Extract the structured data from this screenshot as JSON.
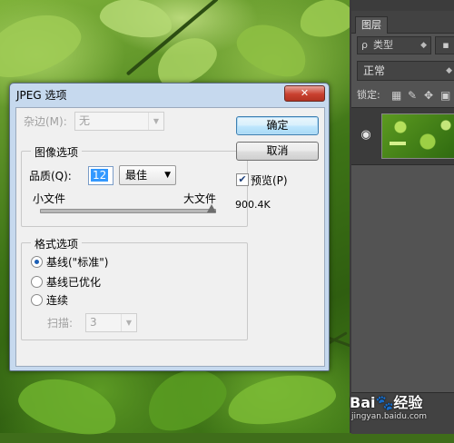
{
  "dialog": {
    "title": "JPEG 选项",
    "close_glyph": "✕",
    "matte_label": "杂边(M):",
    "matte_value": "无",
    "image_options": {
      "group_title": "图像选项",
      "quality_label": "品质(Q):",
      "quality_value": "12",
      "quality_preset": "最佳",
      "small_file_label": "小文件",
      "large_file_label": "大文件",
      "slider_level_percent": 100
    },
    "format_options": {
      "group_title": "格式选项",
      "radio_baseline_standard": "基线(\"标准\")",
      "radio_baseline_optimized": "基线已优化",
      "radio_progressive": "连续",
      "scans_label": "扫描:",
      "scans_value": "3",
      "selected": "baseline_standard"
    },
    "ok_label": "确定",
    "cancel_label": "取消",
    "preview_label": "预览(P)",
    "preview_checked": true,
    "file_size": "900.4K"
  },
  "ps_panel": {
    "tab_label": "图层",
    "filter_icon": "search-icon",
    "filter_glyph": "ρ",
    "filter_label": "类型",
    "blend_mode": "正常",
    "lock_label": "锁定:",
    "eye_glyph": "👁",
    "link_glyph": "∞"
  },
  "watermark": {
    "logo": "Bai🐾经验",
    "url": "jingyan.baidu.com"
  }
}
